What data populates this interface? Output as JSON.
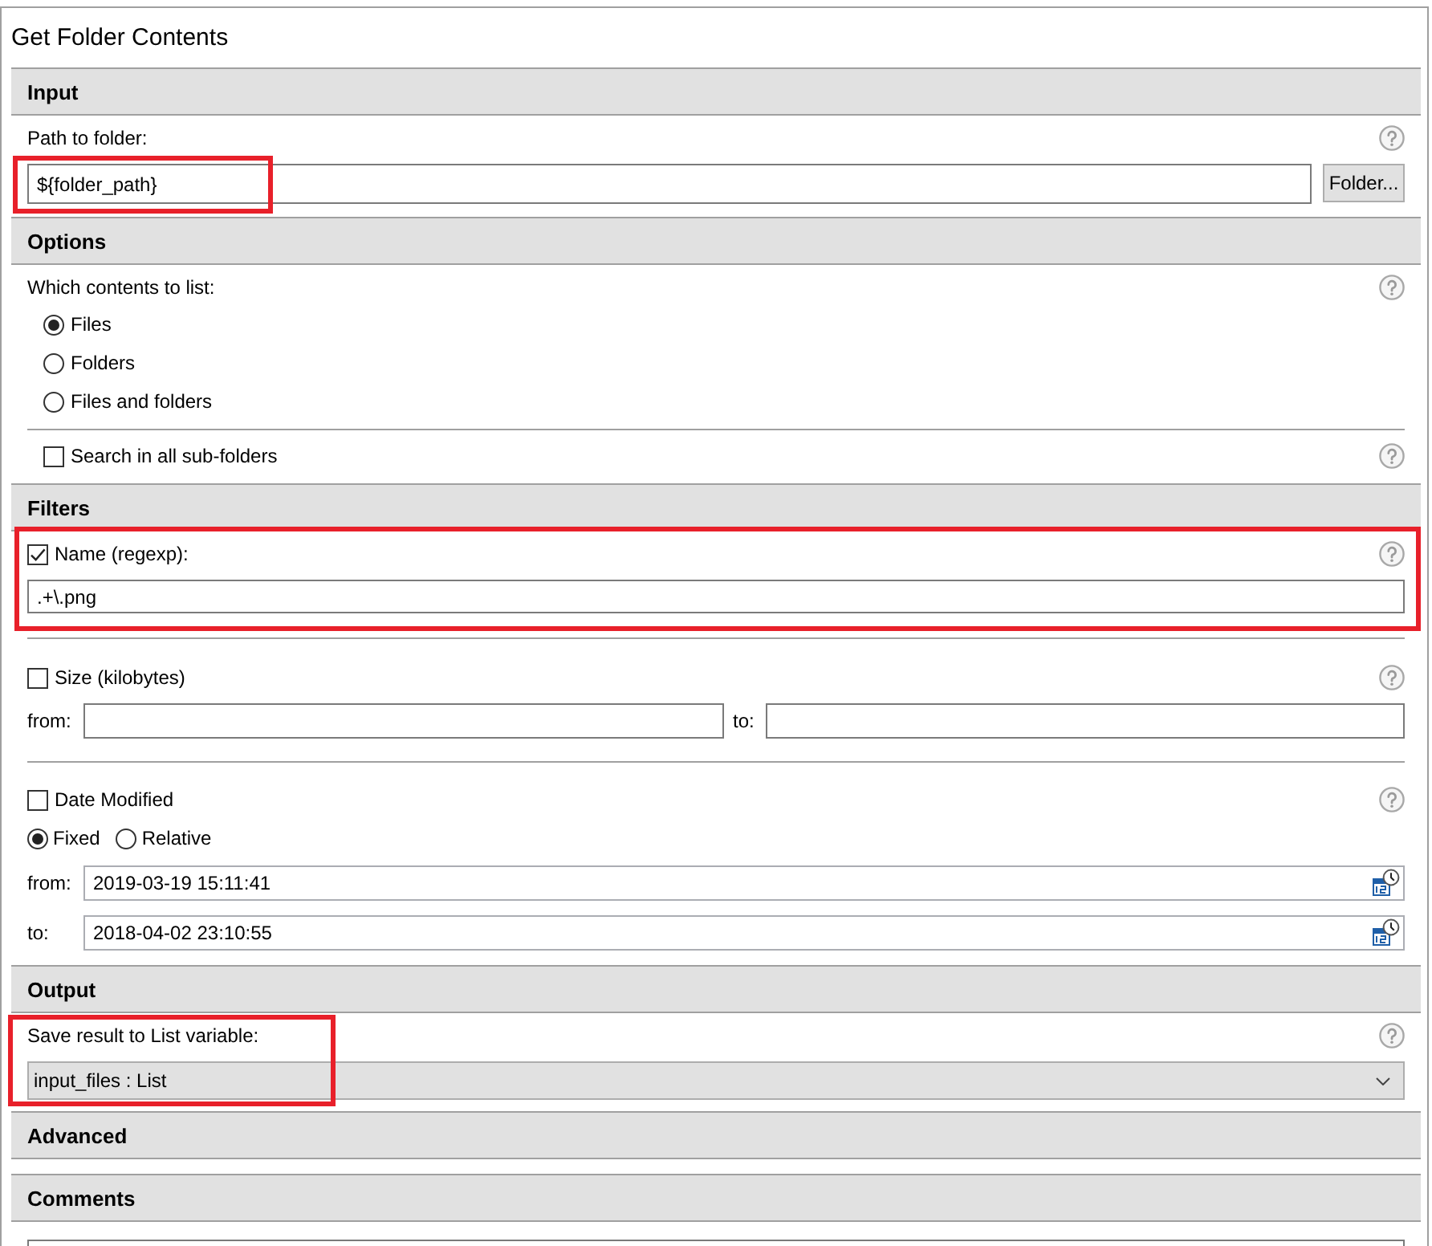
{
  "window": {
    "title": "Get Folder Contents"
  },
  "input": {
    "title": "Input",
    "path": {
      "label": "Path to folder:",
      "value": "${folder_path}",
      "highlighted": true
    },
    "browse_button": "Folder..."
  },
  "options": {
    "title": "Options",
    "contents": {
      "label": "Which contents to list:",
      "choices": [
        {
          "label": "Files",
          "selected": true
        },
        {
          "label": "Folders",
          "selected": false
        },
        {
          "label": "Files and folders",
          "selected": false
        }
      ]
    },
    "subfolders": {
      "label": "Search in all sub-folders",
      "checked": false
    }
  },
  "filters": {
    "title": "Filters",
    "name": {
      "label": "Name (regexp):",
      "checked": true,
      "value": ".+\\.png",
      "highlighted": true
    },
    "size": {
      "label": "Size (kilobytes)",
      "checked": false,
      "from_label": "from:",
      "to_label": "to:"
    },
    "date": {
      "label": "Date Modified",
      "checked": false,
      "modes": [
        {
          "label": "Fixed",
          "selected": true
        },
        {
          "label": "Relative",
          "selected": false
        }
      ],
      "from_label": "from:",
      "from_value": "2019-03-19 15:11:41",
      "to_label": "to:",
      "to_value": "2018-04-02 23:10:55"
    }
  },
  "output": {
    "title": "Output",
    "variable": {
      "label": "Save result to List variable:",
      "value": "input_files : List",
      "highlighted": true
    }
  },
  "advanced": {
    "title": "Advanced"
  },
  "comments": {
    "title": "Comments"
  }
}
